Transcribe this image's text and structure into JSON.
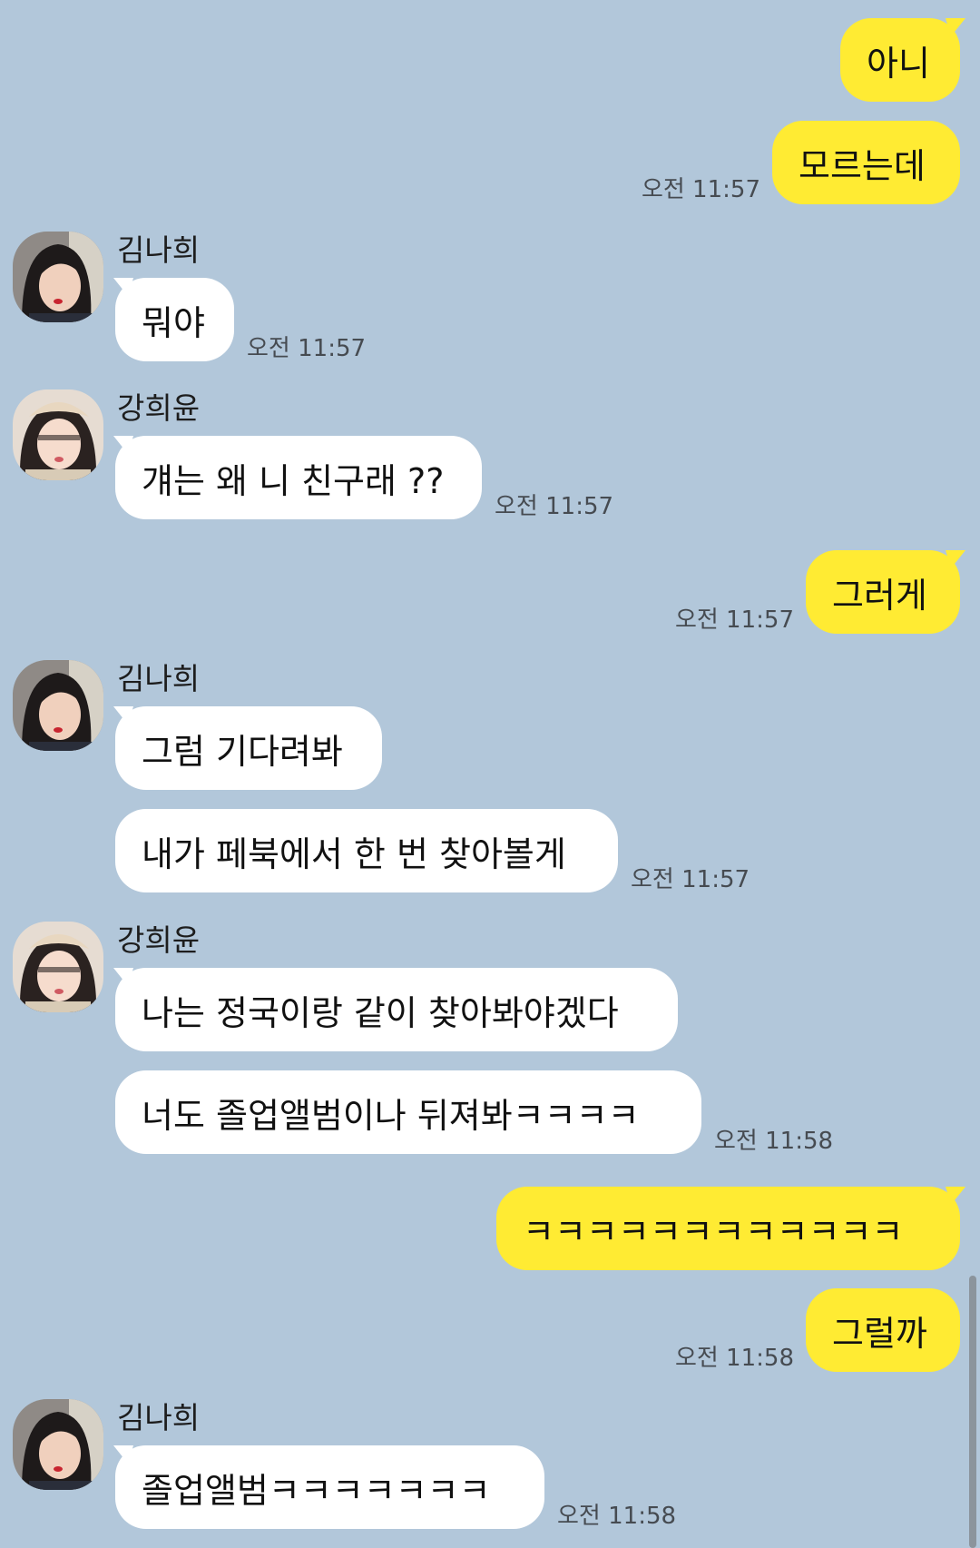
{
  "contacts": {
    "nahee": {
      "name": "김나희",
      "avatar": "profile-photo"
    },
    "heeyoon": {
      "name": "강희윤",
      "avatar": "profile-photo"
    }
  },
  "colors": {
    "background": "#b2c7da",
    "my_bubble": "#ffeb33",
    "their_bubble": "#ffffff"
  },
  "messages": [
    {
      "from": "me",
      "text": "아니"
    },
    {
      "from": "me",
      "text": "모르는데",
      "time": "오전 11:57"
    },
    {
      "from": "김나희",
      "text": "뭐야",
      "time": "오전 11:57"
    },
    {
      "from": "강희윤",
      "text": "걔는 왜 니 친구래 ??",
      "time": "오전 11:57"
    },
    {
      "from": "me",
      "text": "그러게",
      "time": "오전 11:57"
    },
    {
      "from": "김나희",
      "text": "그럼 기다려봐"
    },
    {
      "from": "김나희",
      "text": "내가 페북에서 한 번 찾아볼게",
      "time": "오전 11:57"
    },
    {
      "from": "강희윤",
      "text": "나는 정국이랑 같이 찾아봐야겠다"
    },
    {
      "from": "강희윤",
      "text": "너도 졸업앨범이나 뒤져봐ㅋㅋㅋㅋ",
      "time": "오전 11:58"
    },
    {
      "from": "me",
      "text": "ㅋㅋㅋㅋㅋㅋㅋㅋㅋㅋㅋㅋ"
    },
    {
      "from": "me",
      "text": "그럴까",
      "time": "오전 11:58"
    },
    {
      "from": "김나희",
      "text": "졸업앨범ㅋㅋㅋㅋㅋㅋㅋ",
      "time": "오전 11:58"
    }
  ]
}
